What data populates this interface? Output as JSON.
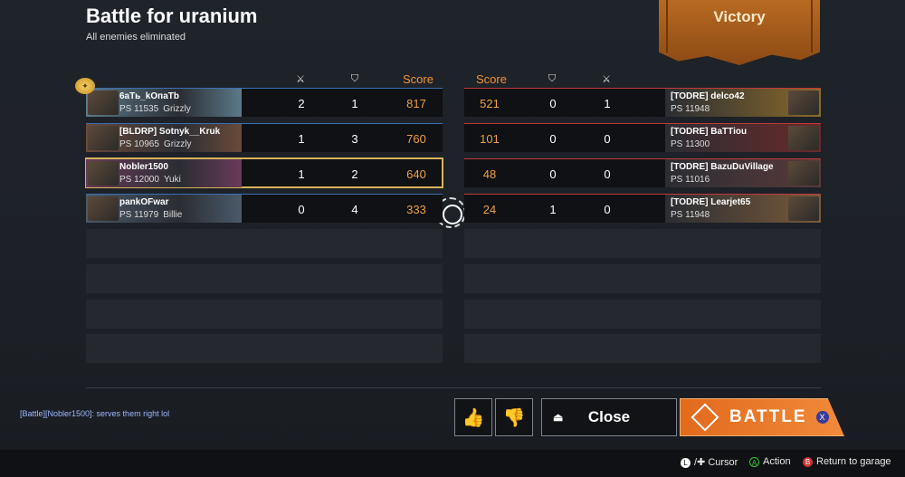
{
  "header": {
    "title": "Battle for uranium",
    "subtitle": "All enemies eliminated",
    "result": "Victory"
  },
  "columns": {
    "score_label": "Score",
    "kills_icon": "kills-icon",
    "assists_icon": "shield-icon"
  },
  "left_team": [
    {
      "name": "6аТь_kОпаТb",
      "ps": "PS 11535",
      "vehicle": "Grizzly",
      "c1": "2",
      "c2": "1",
      "score": "817",
      "emblem": true,
      "color": "#5c7a8a"
    },
    {
      "name": "[BLDRP] Sotnyk__Kruk",
      "ps": "PS 10965",
      "vehicle": "Grizzly",
      "c1": "1",
      "c2": "3",
      "score": "760",
      "color": "#6a4a3a"
    },
    {
      "name": "Nobler1500",
      "ps": "PS 12000",
      "vehicle": "Yuki",
      "c1": "1",
      "c2": "2",
      "score": "640",
      "me": true,
      "color": "#6a3a5a"
    },
    {
      "name": "pankOFwar",
      "ps": "PS 11979",
      "vehicle": "Billie",
      "c1": "0",
      "c2": "4",
      "score": "333",
      "color": "#4a5a6a"
    }
  ],
  "right_team": [
    {
      "name": "[TODRE] delco42",
      "ps": "PS 11948",
      "c1": "0",
      "c2": "1",
      "score": "521",
      "color": "#8a6a2a"
    },
    {
      "name": "[TODRE] BaTTiou",
      "ps": "PS 11300",
      "c1": "0",
      "c2": "0",
      "score": "101",
      "color": "#6a2a2a"
    },
    {
      "name": "[TODRE] BazuDuVillage",
      "ps": "PS 11016",
      "c1": "0",
      "c2": "0",
      "score": "48",
      "color": "#5a3a3a"
    },
    {
      "name": "[TODRE] Learjet65",
      "ps": "PS 11948",
      "c1": "1",
      "c2": "0",
      "score": "24",
      "color": "#7a5a3a"
    }
  ],
  "chat": "[Battle][Nobler1500]: serves them right lol",
  "buttons": {
    "close": "Close",
    "battle": "BATTLE"
  },
  "footer": {
    "cursor": "/✚ Cursor",
    "action": "Action",
    "return": "Return to garage"
  }
}
